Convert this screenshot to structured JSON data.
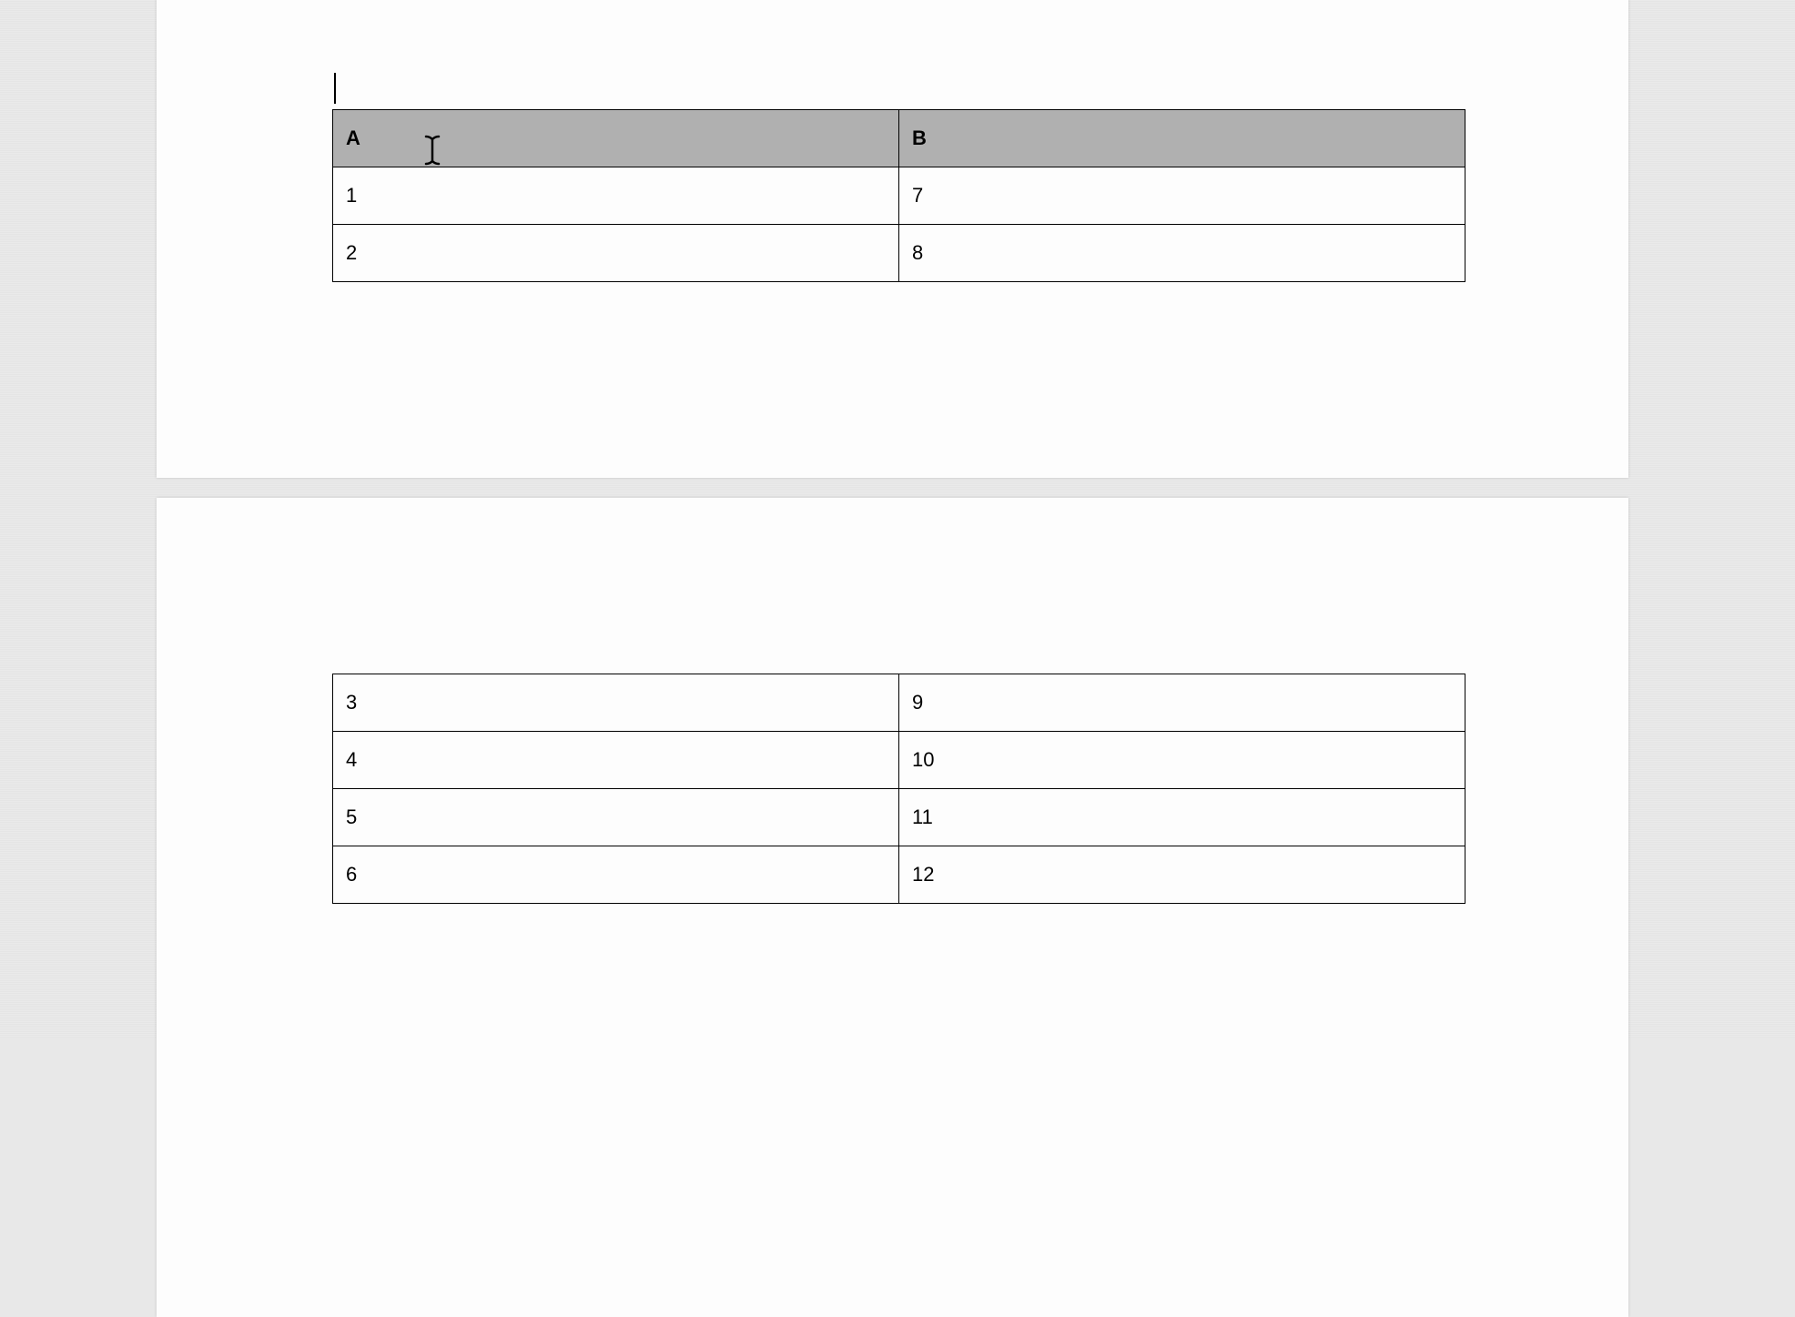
{
  "table1": {
    "headers": [
      "A",
      "B"
    ],
    "rows": [
      [
        "1",
        "7"
      ],
      [
        "2",
        "8"
      ]
    ]
  },
  "table2": {
    "rows": [
      [
        "3",
        "9"
      ],
      [
        "4",
        "10"
      ],
      [
        "5",
        "11"
      ],
      [
        "6",
        "12"
      ]
    ]
  }
}
